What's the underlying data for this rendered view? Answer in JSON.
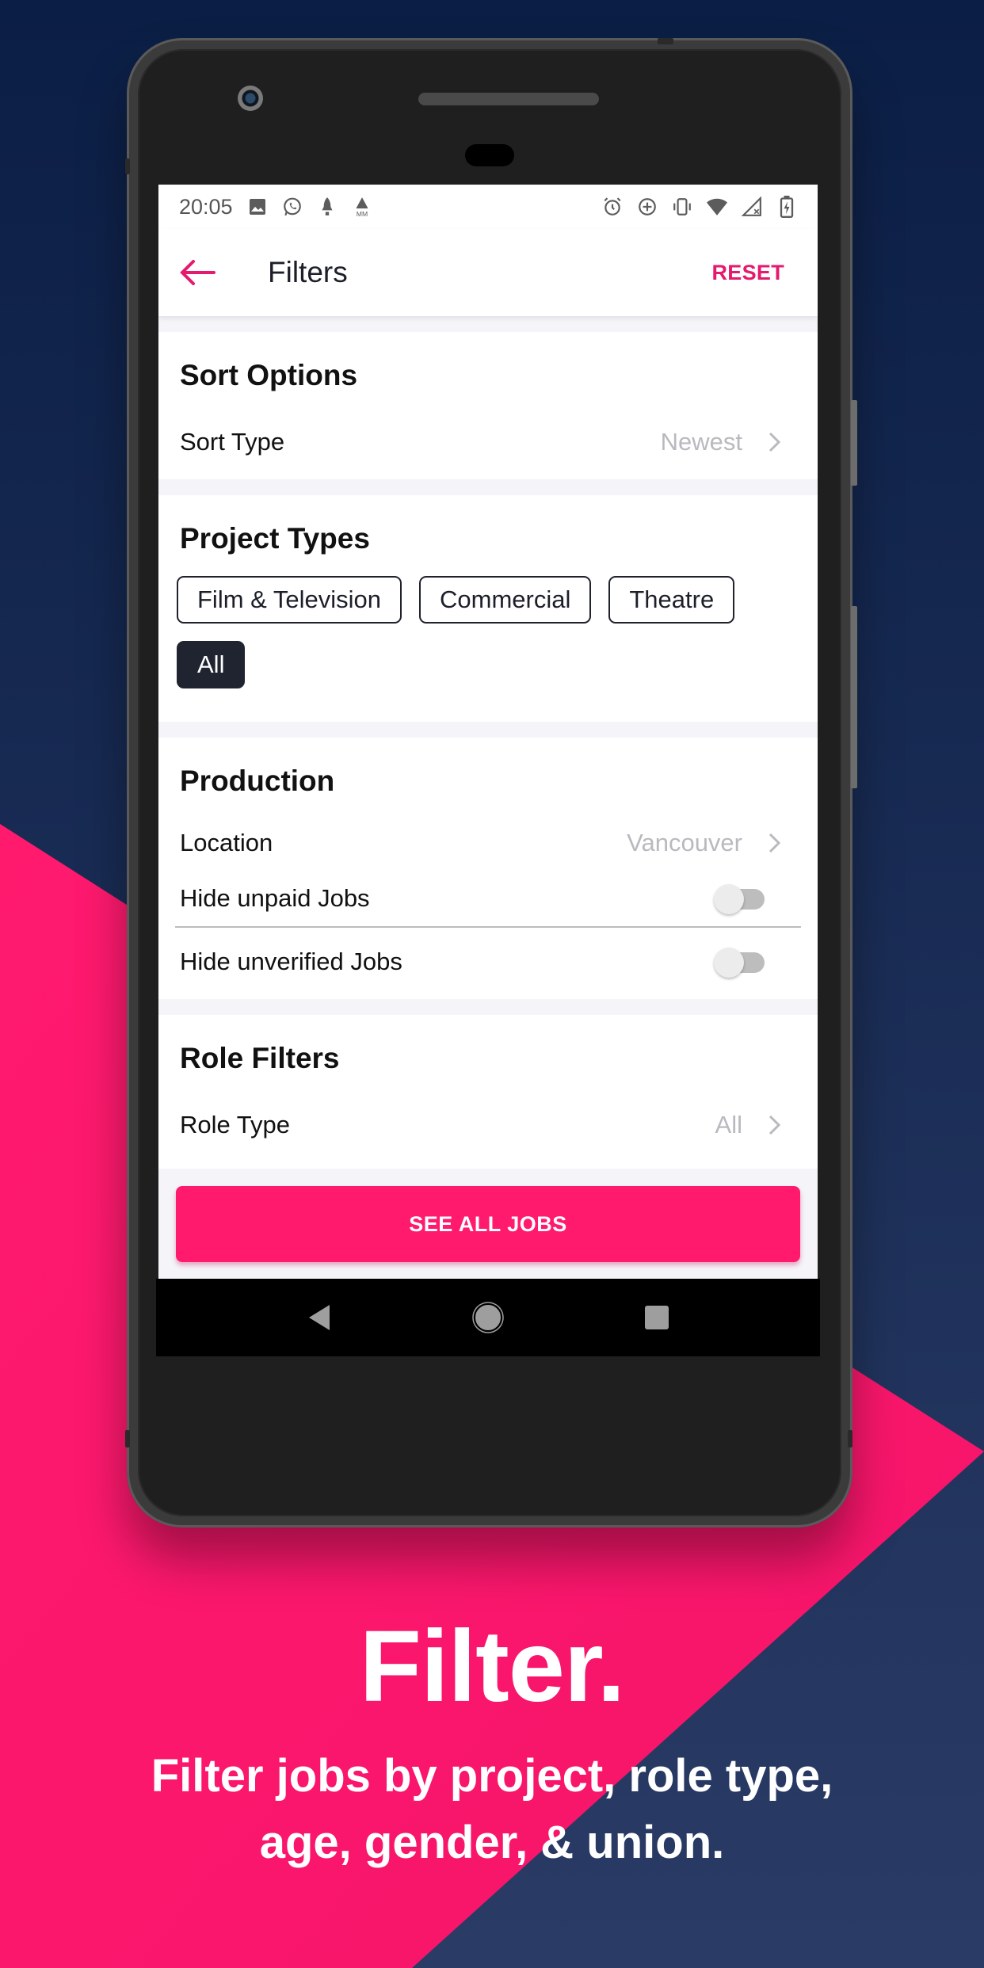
{
  "colors": {
    "navy": "#0e1f46",
    "pink": "#ff1a6e",
    "accent": "#e5196d",
    "chip_active": "#1f2430"
  },
  "status_bar": {
    "time": "20:05",
    "left_icons": [
      "image-icon",
      "whatsapp-icon",
      "rocket-icon",
      "mm-alert-icon"
    ],
    "right_icons": [
      "alarm-icon",
      "data-saver-icon",
      "vibrate-icon",
      "wifi-icon",
      "no-signal-icon",
      "battery-charging-icon"
    ],
    "mm_label": "MM"
  },
  "app_bar": {
    "title": "Filters",
    "reset_label": "RESET"
  },
  "sort_options": {
    "title": "Sort Options",
    "sort_type_label": "Sort Type",
    "sort_type_value": "Newest"
  },
  "project_types": {
    "title": "Project Types",
    "chips": [
      {
        "label": "Film & Television",
        "selected": false
      },
      {
        "label": "Commercial",
        "selected": false
      },
      {
        "label": "Theatre",
        "selected": false
      },
      {
        "label": "All",
        "selected": true
      }
    ]
  },
  "production": {
    "title": "Production",
    "location_label": "Location",
    "location_value": "Vancouver",
    "hide_unpaid_label": "Hide unpaid Jobs",
    "hide_unpaid_on": false,
    "hide_unverified_label": "Hide unverified Jobs",
    "hide_unverified_on": false
  },
  "role_filters": {
    "title": "Role Filters",
    "role_type_label": "Role Type",
    "role_type_value": "All"
  },
  "cta": {
    "label": "SEE ALL JOBS"
  },
  "promo": {
    "headline": "Filter.",
    "subline_1": "Filter jobs by project, role type,",
    "subline_2": "age, gender, & union."
  }
}
